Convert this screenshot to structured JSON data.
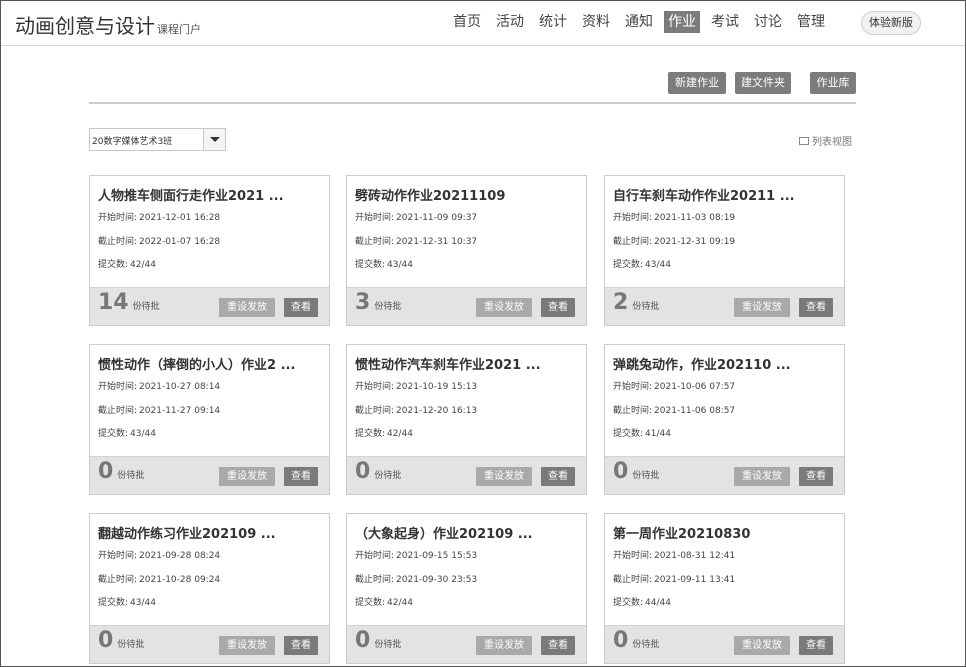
{
  "header": {
    "brand_title": "动画创意与设计",
    "brand_subtitle": "课程门户",
    "nav": [
      {
        "label": "首页",
        "active": false
      },
      {
        "label": "活动",
        "active": false
      },
      {
        "label": "统计",
        "active": false
      },
      {
        "label": "资料",
        "active": false
      },
      {
        "label": "通知",
        "active": false
      },
      {
        "label": "作业",
        "active": true
      },
      {
        "label": "考试",
        "active": false
      },
      {
        "label": "讨论",
        "active": false
      },
      {
        "label": "管理",
        "active": false
      }
    ],
    "new_version_label": "体验新版"
  },
  "toolbar": {
    "new_assignment_label": "新建作业",
    "new_folder_label": "建文件夹",
    "library_label": "作业库"
  },
  "filter": {
    "class_selected": "20数字媒体艺术3班",
    "list_view_label": "列表视图"
  },
  "labels": {
    "start": "开始时间:",
    "end": "截止时间:",
    "submitted": "提交数:",
    "pending_unit": "份待批",
    "reset_button": "重设发放",
    "view_button": "查看"
  },
  "assignments": [
    {
      "title": "人物推车侧面行走作业2021 ...",
      "start": "2021-12-01 16:28",
      "end": "2022-01-07 16:28",
      "submitted": "42/44",
      "pending": "14"
    },
    {
      "title": "劈砖动作作业20211109",
      "start": "2021-11-09 09:37",
      "end": "2021-12-31 10:37",
      "submitted": "43/44",
      "pending": "3"
    },
    {
      "title": "自行车刹车动作作业20211 ...",
      "start": "2021-11-03 08:19",
      "end": "2021-12-31 09:19",
      "submitted": "43/44",
      "pending": "2"
    },
    {
      "title": "惯性动作（摔倒的小人）作业2 ...",
      "start": "2021-10-27 08:14",
      "end": "2021-11-27 09:14",
      "submitted": "43/44",
      "pending": "0"
    },
    {
      "title": "惯性动作汽车刹车作业2021 ...",
      "start": "2021-10-19 15:13",
      "end": "2021-12-20 16:13",
      "submitted": "42/44",
      "pending": "0"
    },
    {
      "title": "弹跳兔动作，作业202110 ...",
      "start": "2021-10-06 07:57",
      "end": "2021-11-06 08:57",
      "submitted": "41/44",
      "pending": "0"
    },
    {
      "title": "翻越动作练习作业202109 ...",
      "start": "2021-09-28 08:24",
      "end": "2021-10-28 09:24",
      "submitted": "43/44",
      "pending": "0"
    },
    {
      "title": "（大象起身）作业202109 ...",
      "start": "2021-09-15 15:53",
      "end": "2021-09-30 23:53",
      "submitted": "42/44",
      "pending": "0"
    },
    {
      "title": "第一周作业20210830",
      "start": "2021-08-31 12:41",
      "end": "2021-09-11 13:41",
      "submitted": "44/44",
      "pending": "0"
    }
  ]
}
